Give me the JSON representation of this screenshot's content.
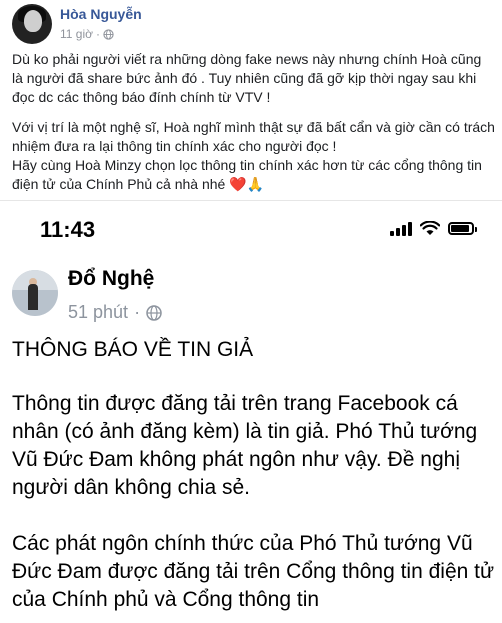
{
  "post": {
    "author": "Hòa Nguyễn",
    "time": "11 giờ",
    "separator": "·",
    "paragraph1": "Dù ko phải người viết ra những dòng fake news này nhưng chính Hoà cũng là người đã share bức ảnh đó . Tuy nhiên cũng đã gỡ kịp thời ngay sau khi đọc dc các thông báo đính chính từ VTV !",
    "paragraph2_line1": "Với vị trí là một nghệ sĩ, Hoà nghĩ mình thật sự đã bất cẩn và giờ cần có trách nhiệm đưa ra lại thông tin chính xác cho người đọc !",
    "paragraph2_line2": "Hãy cùng Hoà Minzy chọn lọc thông tin chính xác hơn từ các cổng thông tin điện tử của Chính Phủ cả nhà nhé",
    "emoji_heart": "❤️",
    "emoji_pray": "🙏"
  },
  "screenshot": {
    "status_time": "11:43",
    "author": "Đổ Nghệ",
    "time": "51 phút",
    "separator": "·",
    "heading": "THÔNG BÁO VỀ TIN GIẢ",
    "paragraph1": "Thông tin được đăng tải trên trang Facebook cá nhân (có ảnh đăng kèm) là tin giả. Phó Thủ tướng Vũ Đức Đam không phát ngôn như vậy. Đề nghị người dân không chia sẻ.",
    "paragraph2": "Các phát ngôn chính thức của Phó Thủ tướng Vũ Đức Đam được đăng tải trên Cổng thông tin điện tử của Chính phủ và Cổng thông tin"
  },
  "colors": {
    "link_blue": "#385898",
    "meta_gray": "#90949c",
    "heart_red": "#e0245e"
  },
  "icons": {
    "globe": "globe-icon",
    "signal": "signal-icon",
    "wifi": "wifi-icon",
    "battery": "battery-icon"
  }
}
